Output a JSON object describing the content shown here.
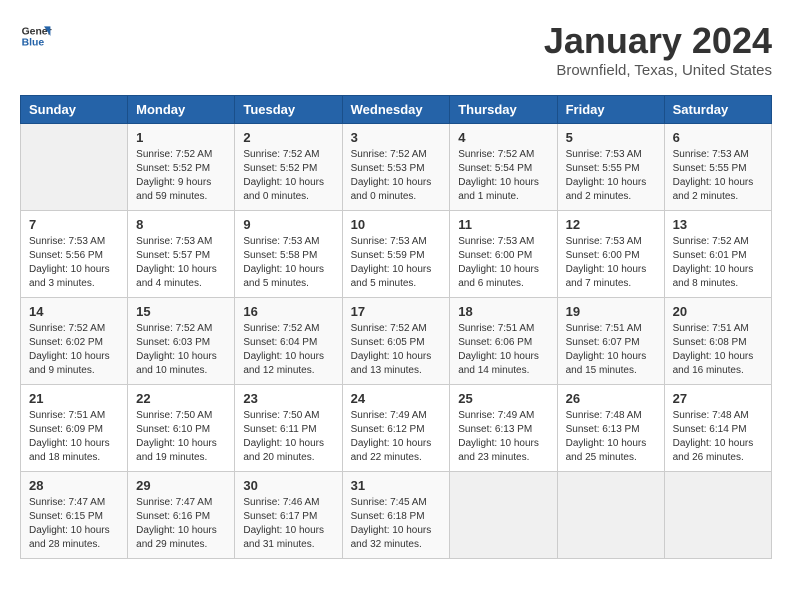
{
  "header": {
    "logo_line1": "General",
    "logo_line2": "Blue",
    "title": "January 2024",
    "subtitle": "Brownfield, Texas, United States"
  },
  "weekdays": [
    "Sunday",
    "Monday",
    "Tuesday",
    "Wednesday",
    "Thursday",
    "Friday",
    "Saturday"
  ],
  "weeks": [
    [
      {
        "day": "",
        "empty": true
      },
      {
        "day": "1",
        "sunrise": "7:52 AM",
        "sunset": "5:52 PM",
        "daylight": "9 hours and 59 minutes."
      },
      {
        "day": "2",
        "sunrise": "7:52 AM",
        "sunset": "5:52 PM",
        "daylight": "10 hours and 0 minutes."
      },
      {
        "day": "3",
        "sunrise": "7:52 AM",
        "sunset": "5:53 PM",
        "daylight": "10 hours and 0 minutes."
      },
      {
        "day": "4",
        "sunrise": "7:52 AM",
        "sunset": "5:54 PM",
        "daylight": "10 hours and 1 minute."
      },
      {
        "day": "5",
        "sunrise": "7:53 AM",
        "sunset": "5:55 PM",
        "daylight": "10 hours and 2 minutes."
      },
      {
        "day": "6",
        "sunrise": "7:53 AM",
        "sunset": "5:55 PM",
        "daylight": "10 hours and 2 minutes."
      }
    ],
    [
      {
        "day": "7",
        "sunrise": "7:53 AM",
        "sunset": "5:56 PM",
        "daylight": "10 hours and 3 minutes."
      },
      {
        "day": "8",
        "sunrise": "7:53 AM",
        "sunset": "5:57 PM",
        "daylight": "10 hours and 4 minutes."
      },
      {
        "day": "9",
        "sunrise": "7:53 AM",
        "sunset": "5:58 PM",
        "daylight": "10 hours and 5 minutes."
      },
      {
        "day": "10",
        "sunrise": "7:53 AM",
        "sunset": "5:59 PM",
        "daylight": "10 hours and 5 minutes."
      },
      {
        "day": "11",
        "sunrise": "7:53 AM",
        "sunset": "6:00 PM",
        "daylight": "10 hours and 6 minutes."
      },
      {
        "day": "12",
        "sunrise": "7:53 AM",
        "sunset": "6:00 PM",
        "daylight": "10 hours and 7 minutes."
      },
      {
        "day": "13",
        "sunrise": "7:52 AM",
        "sunset": "6:01 PM",
        "daylight": "10 hours and 8 minutes."
      }
    ],
    [
      {
        "day": "14",
        "sunrise": "7:52 AM",
        "sunset": "6:02 PM",
        "daylight": "10 hours and 9 minutes."
      },
      {
        "day": "15",
        "sunrise": "7:52 AM",
        "sunset": "6:03 PM",
        "daylight": "10 hours and 10 minutes."
      },
      {
        "day": "16",
        "sunrise": "7:52 AM",
        "sunset": "6:04 PM",
        "daylight": "10 hours and 12 minutes."
      },
      {
        "day": "17",
        "sunrise": "7:52 AM",
        "sunset": "6:05 PM",
        "daylight": "10 hours and 13 minutes."
      },
      {
        "day": "18",
        "sunrise": "7:51 AM",
        "sunset": "6:06 PM",
        "daylight": "10 hours and 14 minutes."
      },
      {
        "day": "19",
        "sunrise": "7:51 AM",
        "sunset": "6:07 PM",
        "daylight": "10 hours and 15 minutes."
      },
      {
        "day": "20",
        "sunrise": "7:51 AM",
        "sunset": "6:08 PM",
        "daylight": "10 hours and 16 minutes."
      }
    ],
    [
      {
        "day": "21",
        "sunrise": "7:51 AM",
        "sunset": "6:09 PM",
        "daylight": "10 hours and 18 minutes."
      },
      {
        "day": "22",
        "sunrise": "7:50 AM",
        "sunset": "6:10 PM",
        "daylight": "10 hours and 19 minutes."
      },
      {
        "day": "23",
        "sunrise": "7:50 AM",
        "sunset": "6:11 PM",
        "daylight": "10 hours and 20 minutes."
      },
      {
        "day": "24",
        "sunrise": "7:49 AM",
        "sunset": "6:12 PM",
        "daylight": "10 hours and 22 minutes."
      },
      {
        "day": "25",
        "sunrise": "7:49 AM",
        "sunset": "6:13 PM",
        "daylight": "10 hours and 23 minutes."
      },
      {
        "day": "26",
        "sunrise": "7:48 AM",
        "sunset": "6:13 PM",
        "daylight": "10 hours and 25 minutes."
      },
      {
        "day": "27",
        "sunrise": "7:48 AM",
        "sunset": "6:14 PM",
        "daylight": "10 hours and 26 minutes."
      }
    ],
    [
      {
        "day": "28",
        "sunrise": "7:47 AM",
        "sunset": "6:15 PM",
        "daylight": "10 hours and 28 minutes."
      },
      {
        "day": "29",
        "sunrise": "7:47 AM",
        "sunset": "6:16 PM",
        "daylight": "10 hours and 29 minutes."
      },
      {
        "day": "30",
        "sunrise": "7:46 AM",
        "sunset": "6:17 PM",
        "daylight": "10 hours and 31 minutes."
      },
      {
        "day": "31",
        "sunrise": "7:45 AM",
        "sunset": "6:18 PM",
        "daylight": "10 hours and 32 minutes."
      },
      {
        "day": "",
        "empty": true
      },
      {
        "day": "",
        "empty": true
      },
      {
        "day": "",
        "empty": true
      }
    ]
  ]
}
